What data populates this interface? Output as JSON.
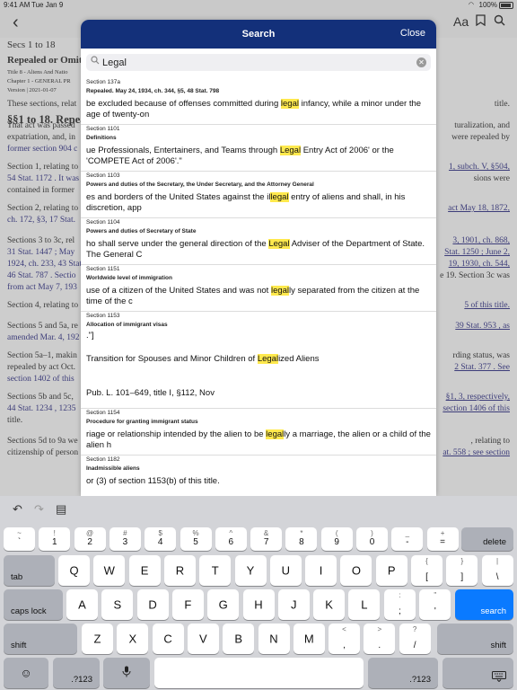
{
  "status": {
    "time": "9:41 AM",
    "date": "Tue Jan 9",
    "battery": "100%"
  },
  "topnav": {
    "aa": "Aa"
  },
  "doc": {
    "secs": "Secs 1 to 18",
    "repealed": "Repealed or Omitt",
    "meta1": "Title 8 - Aliens And Natio",
    "meta2": "Chapter 1 - GENERAL PR",
    "meta3": "Version | 2021-01-07",
    "heading": "§§1 to 18. Repea",
    "paras": [
      {
        "l": "These sections, relat",
        "r": "title."
      },
      {
        "l": "That act was passed",
        "r": "turalization, and"
      },
      {
        "l": "expatriation, and, in",
        "r": "were repealed by"
      },
      {
        "l": "former section 904 c",
        "r": ""
      },
      {
        "l": "Section 1, relating to",
        "r": "1, subch. V, §504,"
      },
      {
        "l": "54 Stat. 1172 . It was",
        "r": "sions were"
      },
      {
        "l": "contained in former",
        "r": ""
      },
      {
        "l": "Section 2, relating to",
        "r": "act May 18, 1872,"
      },
      {
        "l": "ch. 172, §3, 17 Stat.",
        "r": ""
      },
      {
        "l": "Sections 3 to 3c, rel",
        "r": "3, 1901, ch. 868,"
      },
      {
        "l": "31 Stat. 1447 ; May",
        "r": "Stat. 1250 ; June 2,"
      },
      {
        "l": "1924, ch. 233, 43 Stat",
        "r": "19, 1930, ch. 544,"
      },
      {
        "l": "46 Stat. 787 . Sectio",
        "r": "e 19. Section 3c was"
      },
      {
        "l": "from act May 7, 193",
        "r": ""
      },
      {
        "l": "Section 4, relating to",
        "r": "5 of this title."
      },
      {
        "l": "Sections 5 and 5a, re",
        "r": "39 Stat. 953 , as"
      },
      {
        "l": "amended Mar. 4, 192",
        "r": ""
      },
      {
        "l": "Section 5a–1, makin",
        "r": "rding status, was"
      },
      {
        "l": "repealed by act Oct.",
        "r": "2 Stat. 377 . See"
      },
      {
        "l": "section 1402 of this",
        "r": ""
      },
      {
        "l": "Sections 5b and 5c,",
        "r": "§1, 3, respectively,"
      },
      {
        "l": "44 Stat. 1234 , 1235",
        "r": "section 1406 of this"
      },
      {
        "l": "title.",
        "r": ""
      },
      {
        "l": "Sections 5d to 9a we",
        "r": ", relating to"
      },
      {
        "l": "citizenship of person",
        "r": "at. 558 ; see section"
      }
    ]
  },
  "search": {
    "title": "Search",
    "close": "Close",
    "query": "Legal",
    "results": [
      {
        "section": "Section 137a",
        "sub": "Repealed. May 24, 1934, ch. 344, §5, 48 Stat. 798",
        "pre": " be excluded because of offenses committed during ",
        "hl": "legal",
        "post": " infancy, while a minor under the age of twenty-on"
      },
      {
        "section": "Section 1101",
        "sub": "Definitions",
        "pre": "ue Professionals, Entertainers, and Teams through ",
        "hl": "Legal",
        "post": " Entry Act of 2006' or the 'COMPETE Act of 2006'.\""
      },
      {
        "section": "Section 1103",
        "sub": "Powers and duties of the Secretary, the Under Secretary, and the Attorney General",
        "pre": "es and borders of the United States against the il",
        "hl": "legal",
        "post": " entry of aliens and shall, in his discretion, app"
      },
      {
        "section": "Section 1104",
        "sub": "Powers and duties of Secretary of State",
        "pre": "ho shall serve under the general direction of the ",
        "hl": "Legal",
        "post": " Adviser of the Department of State. The General C"
      },
      {
        "section": "Section 1151",
        "sub": "Worldwide level of immigration",
        "pre": "use of a citizen of the United States and was not ",
        "hl": "legal",
        "post": "ly separated from the citizen at the time of the c"
      },
      {
        "section": "Section 1153",
        "sub": "Allocation of immigrant visas",
        "line1": ".\"]",
        "pre": "Transition for Spouses and Minor Children of ",
        "hl": "Legal",
        "post": "ized Aliens",
        "line3": "Pub. L. 101–649, title I, §112, Nov"
      },
      {
        "section": "Section 1154",
        "sub": "Procedure for granting immigrant status",
        "pre": "riage or relationship intended by the alien to be ",
        "hl": "legal",
        "post": "ly a marriage, the alien or a child of the alien h"
      },
      {
        "section": "Section 1182",
        "sub": "Inadmissible aliens",
        "pre": "or (3) of section 1153(b) of this title.",
        "hl": "",
        "post": ""
      }
    ]
  },
  "keyboard": {
    "row1": [
      [
        "~",
        "`"
      ],
      [
        "!",
        "1"
      ],
      [
        "@",
        "2"
      ],
      [
        "#",
        "3"
      ],
      [
        "$",
        "4"
      ],
      [
        "%",
        "5"
      ],
      [
        "^",
        "6"
      ],
      [
        "&",
        "7"
      ],
      [
        "*",
        "8"
      ],
      [
        "(",
        "9"
      ],
      [
        ")",
        "0"
      ],
      [
        "_",
        "-"
      ],
      [
        "+",
        "="
      ]
    ],
    "delete": "delete",
    "tab": "tab",
    "row2": [
      "Q",
      "W",
      "E",
      "R",
      "T",
      "Y",
      "U",
      "I",
      "O",
      "P"
    ],
    "row2b": [
      [
        "{",
        "["
      ],
      [
        "}",
        "]"
      ],
      [
        "|",
        "\\"
      ]
    ],
    "caps": "caps lock",
    "row3": [
      "A",
      "S",
      "D",
      "F",
      "G",
      "H",
      "J",
      "K",
      "L"
    ],
    "row3b": [
      [
        ":",
        ";"
      ],
      [
        "\"",
        "'"
      ]
    ],
    "search": "search",
    "shift": "shift",
    "row4": [
      "Z",
      "X",
      "C",
      "V",
      "B",
      "N",
      "M"
    ],
    "row4b": [
      [
        "<",
        ","
      ],
      [
        ">",
        "."
      ],
      [
        "?",
        "/"
      ]
    ],
    "num": ".?123"
  }
}
